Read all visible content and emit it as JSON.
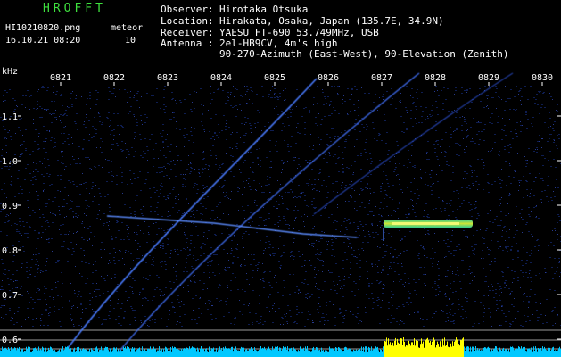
{
  "app": {
    "title": "HROFFT",
    "file_name": "HI10210820.png",
    "datetime": "16.10.21 08:20"
  },
  "meteor": {
    "label": "meteor",
    "count": "10"
  },
  "info": [
    {
      "key": "Observer",
      "value": "Hirotaka Otsuka"
    },
    {
      "key": "Location",
      "value": "Hirakata, Osaka, Japan (135.7E, 34.9N)"
    },
    {
      "key": "Receiver",
      "value": "YAESU FT-690 53.749MHz, USB"
    },
    {
      "key": "Antenna",
      "value": "2el-HB9CV, 4m's high"
    },
    {
      "key": "",
      "value": "90-270-Azimuth (East-West), 90-Elevation (Zenith)"
    }
  ],
  "info_sep": ":",
  "axes": {
    "y_unit": "kHz",
    "y_ticks": [
      "1.1",
      "1.0",
      "0.9",
      "0.8",
      "0.7",
      "0.6"
    ],
    "x_ticks": [
      "0821",
      "0822",
      "0823",
      "0824",
      "0825",
      "0826",
      "0827",
      "0828",
      "0829",
      "0830"
    ]
  },
  "colors": {
    "background": "#000000",
    "noise": "#10205a",
    "trace": "#4a7bff",
    "echo_core": "#e8ff3a",
    "echo_edge": "#33e0a0",
    "bottom_signal": "#00c8ff",
    "bottom_peak": "#ffff00",
    "title": "#3ee03e"
  }
}
